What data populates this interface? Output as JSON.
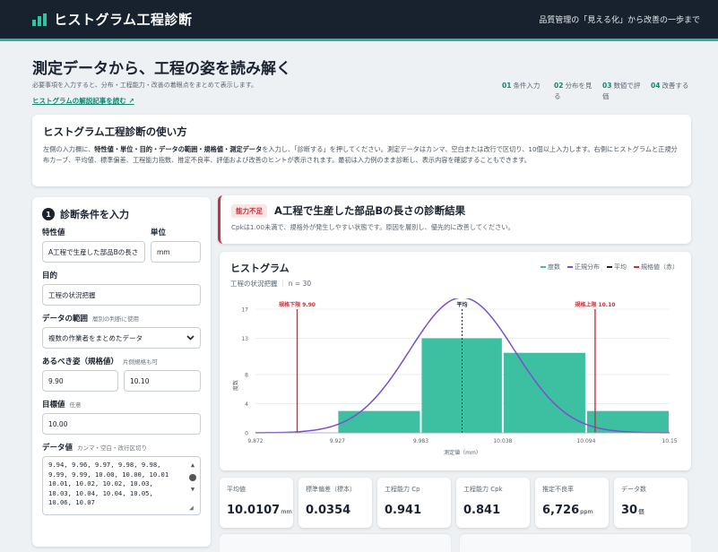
{
  "header": {
    "app_title": "ヒストグラム工程診断",
    "tagline": "品質管理の「見える化」から改善の一歩まで"
  },
  "hero": {
    "title": "測定データから、工程の姿を読み解く",
    "subtitle": "必要事項を入力すると、分布・工程能力・改善の着眼点をまとめて表示します。",
    "link": "ヒストグラムの解説記事を読む ↗",
    "steps": [
      {
        "num": "01",
        "label": "条件入力"
      },
      {
        "num": "02",
        "label": "分布を見る"
      },
      {
        "num": "03",
        "label": "数値で評価"
      },
      {
        "num": "04",
        "label": "改善する"
      }
    ]
  },
  "howto": {
    "title": "ヒストグラム工程診断の使い方",
    "p1": "左側の入力欄に、",
    "b1": "特性値・単位・目的・データの範囲・規格値・測定データ",
    "p2": "を入力し、「診断する」を押してください。測定データはカンマ、空白または改行で区切り、10個以上入力します。右側にヒストグラムと正規分布カーブ、平均値、標準偏差、工程能力指数、推定不良率、評価および改善のヒントが表示されます。最初は入力例のまま診断し、表示内容を確認することもできます。"
  },
  "form": {
    "section_num": "1",
    "section_title": "診断条件を入力",
    "char_label": "特性値",
    "unit_label": "単位",
    "char_value": "A工程で生産した部品Bの長さ",
    "unit_value": "mm",
    "purpose_label": "目的",
    "purpose_value": "工程の状況把握",
    "range_label": "データの範囲",
    "range_hint": "層別の判断に使用",
    "range_value": "複数の作業者をまとめたデータ",
    "spec_label": "あるべき姿（規格値）",
    "spec_hint": "片側規格も可",
    "spec_low": "9.90",
    "spec_high": "10.10",
    "target_label": "目標値",
    "target_hint": "任意",
    "target_value": "10.00",
    "data_label": "データ値",
    "data_hint": "カンマ・空白・改行区切り",
    "data_value": "9.94, 9.96, 9.97, 9.98, 9.98,\n9.99, 9.99, 10.00, 10.00, 10.01\n10.01, 10.02, 10.02, 10.03,\n10.03, 10.04, 10.04, 10.05,\n10.06, 10.07"
  },
  "diagnosis": {
    "badge": "能力不足",
    "title": "A工程で生産した部品Bの長さの診断結果",
    "message": "Cpkは1.00未満で、規格外が発生しやすい状態です。原因を層別し、優先的に改善してください。"
  },
  "histogram": {
    "title": "ヒストグラム",
    "purpose": "工程の状況把握",
    "sep": "｜",
    "n_label": "n = 30",
    "legend": {
      "freq": "度数",
      "normal": "正規分布",
      "mean": "平均",
      "spec": "規格値（赤）"
    },
    "colors": {
      "bar": "#3dbfa2",
      "curve": "#7b4fc9",
      "spec": "#c8323b",
      "mean": "#1b2330"
    }
  },
  "chart_data": {
    "type": "bar",
    "bins": [
      {
        "from": 9.872,
        "to": 9.927,
        "count": 0
      },
      {
        "from": 9.927,
        "to": 9.983,
        "count": 3
      },
      {
        "from": 9.983,
        "to": 10.038,
        "count": 13
      },
      {
        "from": 10.038,
        "to": 10.094,
        "count": 11
      },
      {
        "from": 10.094,
        "to": 10.15,
        "count": 3
      }
    ],
    "x_ticks": [
      "9.872",
      "9.927",
      "9.983",
      "10.038",
      "10.094",
      "10.15"
    ],
    "y_ticks": [
      "0",
      "4",
      "8",
      "13",
      "17"
    ],
    "xlim": [
      9.872,
      10.15
    ],
    "ylim": [
      0,
      17
    ],
    "xlabel": "測定値（mm）",
    "ylabel": "度数",
    "mean": 10.0107,
    "sd": 0.0354,
    "lsl": 9.9,
    "usl": 10.1,
    "lsl_label": "規格下限 9.90",
    "usl_label": "規格上限 10.10",
    "mean_label": "平均"
  },
  "stats": [
    {
      "key": "平均値",
      "value": "10.0107",
      "unit": "mm"
    },
    {
      "key": "標準偏差（標本）",
      "value": "0.0354",
      "unit": ""
    },
    {
      "key": "工程能力 Cp",
      "value": "0.941",
      "unit": ""
    },
    {
      "key": "工程能力 Cpk",
      "value": "0.841",
      "unit": ""
    },
    {
      "key": "推定不良率",
      "value": "6,726",
      "unit": "ppm"
    },
    {
      "key": "データ数",
      "value": "30",
      "unit": "個"
    }
  ]
}
